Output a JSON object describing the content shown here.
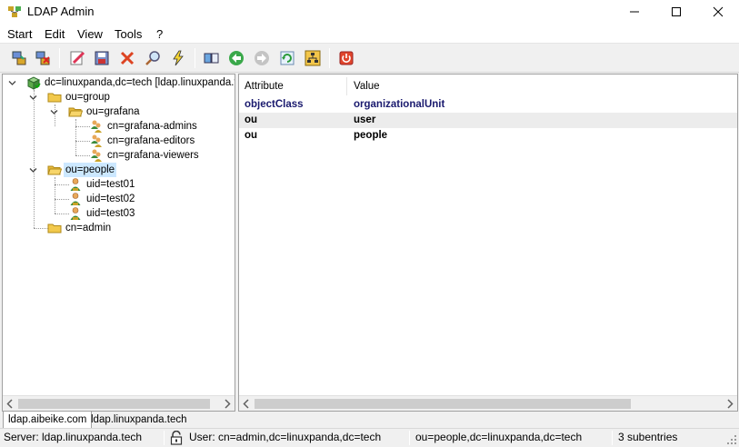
{
  "window": {
    "title": "LDAP Admin"
  },
  "menu": [
    "Start",
    "Edit",
    "View",
    "Tools",
    "?"
  ],
  "toolbar": {
    "buttons": [
      "connect-icon",
      "disconnect-icon",
      "edit-entry-icon",
      "save-icon",
      "delete-icon",
      "search-icon",
      "lightning-icon",
      "book-icon",
      "back-icon",
      "forward-icon",
      "refresh-icon",
      "tree-icon",
      "exit-icon"
    ]
  },
  "tree": {
    "root": "dc=linuxpanda,dc=tech [ldap.linuxpanda.t",
    "group": "ou=group",
    "grafana": "ou=grafana",
    "admins": "cn=grafana-admins",
    "editors": "cn=grafana-editors",
    "viewers": "cn=grafana-viewers",
    "people": "ou=people",
    "test01": "uid=test01",
    "test02": "uid=test02",
    "test03": "uid=test03",
    "admin": "cn=admin"
  },
  "attributes": {
    "headers": {
      "attribute": "Attribute",
      "value": "Value"
    },
    "rows": [
      {
        "attribute": "objectClass",
        "value": "organizationalUnit"
      },
      {
        "attribute": "ou",
        "value": "user"
      },
      {
        "attribute": "ou",
        "value": "people"
      }
    ]
  },
  "tabs": [
    "ldap.aibeike.com",
    "ldap.linuxpanda.tech"
  ],
  "status": {
    "server": "Server: ldap.linuxpanda.tech",
    "user": "User: cn=admin,dc=linuxpanda,dc=tech",
    "dn": "ou=people,dc=linuxpanda,dc=tech",
    "subentries": "3 subentries"
  },
  "colors": {
    "selection": "#cce8ff",
    "objectclass_text": "#1a1a6e",
    "folder": "#f2c94c"
  }
}
